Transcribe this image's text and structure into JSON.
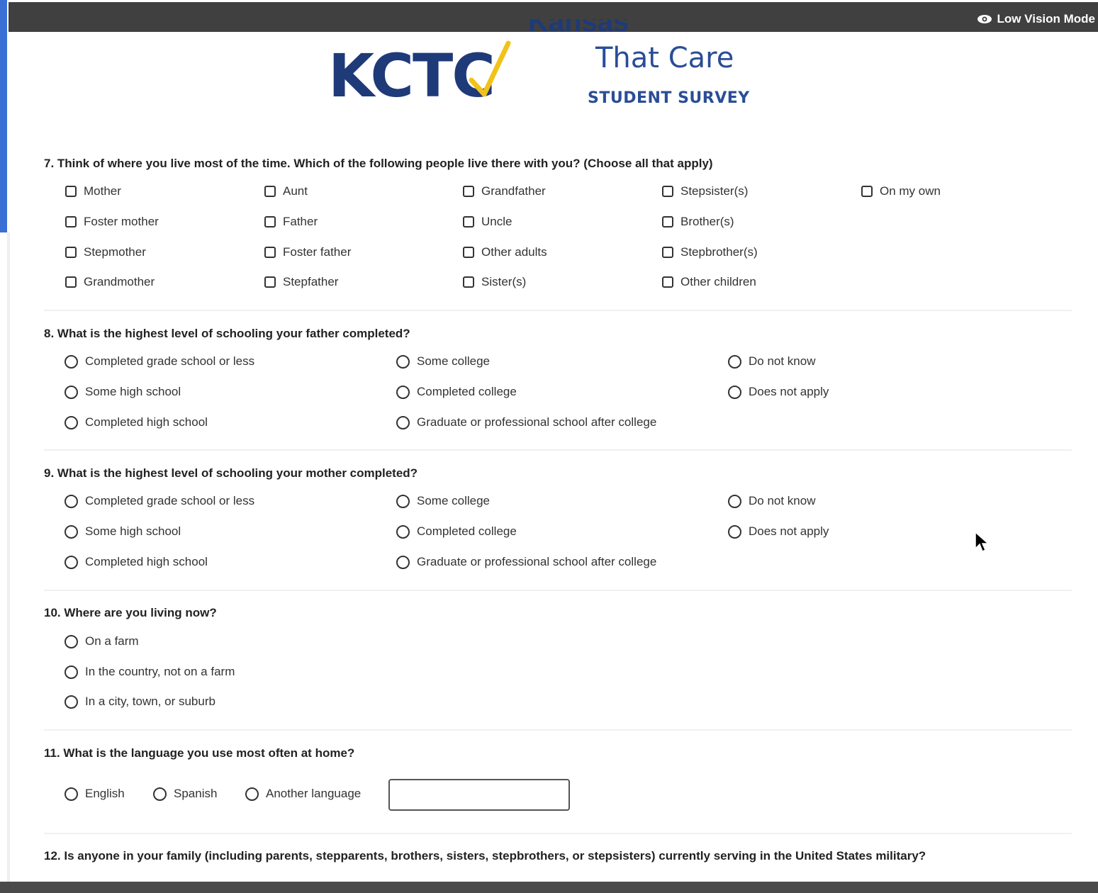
{
  "header": {
    "low_vision_label": "Low Vision Mode",
    "low_vision_icon": "eye-icon"
  },
  "logo": {
    "acronym": "KCTC",
    "partial_title": "Kansas Communities",
    "tagline": "That Care",
    "subtitle": "STUDENT SURVEY"
  },
  "colors": {
    "brand_blue": "#1e3a78",
    "brand_gold": "#f2c21a",
    "topbar": "#404040",
    "accent": "#3b6fd6"
  },
  "q7": {
    "title": "7. Think of where you live most of the time. Which of the following people live there with you? (Choose all that apply)",
    "options": [
      "Mother",
      "Foster mother",
      "Stepmother",
      "Grandmother",
      "Aunt",
      "Father",
      "Foster father",
      "Stepfather",
      "Grandfather",
      "Uncle",
      "Other adults",
      "Sister(s)",
      "Stepsister(s)",
      "Brother(s)",
      "Stepbrother(s)",
      "Other children",
      "On my own"
    ]
  },
  "q8": {
    "title": "8. What is the highest level of schooling your father completed?",
    "options": [
      "Completed grade school or less",
      "Some high school",
      "Completed high school",
      "Some college",
      "Completed college",
      "Graduate or professional school after college",
      "Do not know",
      "Does not apply"
    ]
  },
  "q9": {
    "title": "9. What is the highest level of schooling your mother completed?",
    "options": [
      "Completed grade school or less",
      "Some high school",
      "Completed high school",
      "Some college",
      "Completed college",
      "Graduate or professional school after college",
      "Do not know",
      "Does not apply"
    ]
  },
  "q10": {
    "title": "10. Where are you living now?",
    "options": [
      "On a farm",
      "In the country, not on a farm",
      "In a city, town, or suburb"
    ]
  },
  "q11": {
    "title": "11. What is the language you use most often at home?",
    "options": [
      "English",
      "Spanish",
      "Another language"
    ],
    "other_value": ""
  },
  "q12": {
    "title": "12. Is anyone in your family (including parents, stepparents, brothers, sisters, stepbrothers, or stepsisters) currently serving in the United States military?"
  }
}
